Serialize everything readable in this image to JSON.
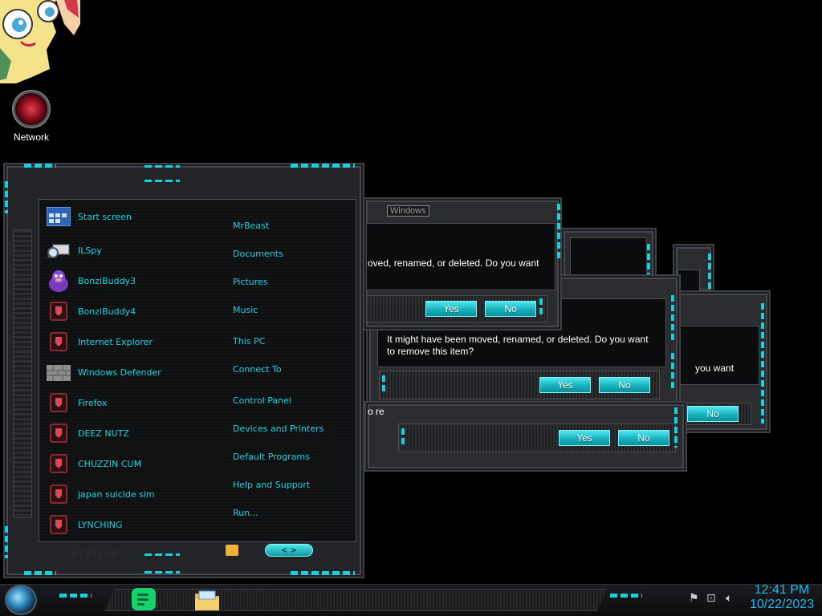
{
  "desktop": {
    "icons": [
      {
        "label": "Network"
      }
    ]
  },
  "start_menu": {
    "programs": [
      {
        "label": "Start screen",
        "icon": "start-screen-icon"
      },
      {
        "label": "ILSpy",
        "icon": "ilspy-icon"
      },
      {
        "label": "BonziBuddy3",
        "icon": "bonzi-icon"
      },
      {
        "label": "BonziBuddy4",
        "icon": "shield-icon"
      },
      {
        "label": "Internet Explorer",
        "icon": "shield-icon"
      },
      {
        "label": "Windows Defender",
        "icon": "wall-icon"
      },
      {
        "label": "Firefox",
        "icon": "shield-icon"
      },
      {
        "label": "DEEZ NUTZ",
        "icon": "shield-icon"
      },
      {
        "label": "CHUZZIN CUM",
        "icon": "shield-icon"
      },
      {
        "label": "japan suicide sim",
        "icon": "shield-icon"
      },
      {
        "label": "LYNCHING",
        "icon": "shield-icon"
      }
    ],
    "links": [
      {
        "label": "MrBeast"
      },
      {
        "label": "Documents"
      },
      {
        "label": "Pictures"
      },
      {
        "label": "Music"
      },
      {
        "label": "This PC"
      },
      {
        "label": "Connect To"
      },
      {
        "label": "Control Panel"
      },
      {
        "label": "Devices and Printers"
      },
      {
        "label": "Default Programs"
      },
      {
        "label": "Help and Support"
      },
      {
        "label": "Run..."
      }
    ],
    "footer_label": "SYSTEM",
    "power_glyph": "< >"
  },
  "dialogs": {
    "title": "Windows",
    "message_line1": "It might have been moved, renamed, or deleted. Do you want",
    "message_line2": "to remove this item?",
    "partial_front_text": "oved, renamed, or deleted. Do you want",
    "partial_right_text": "you want",
    "partial_left_text": "o re",
    "yes_label": "Yes",
    "no_label": "No"
  },
  "taskbar": {
    "time": "12:41 PM",
    "date": "10/22/2023"
  },
  "colors": {
    "accent": "#17c9d4",
    "clock": "#27b6e6",
    "menu_text": "#1fd2df"
  }
}
